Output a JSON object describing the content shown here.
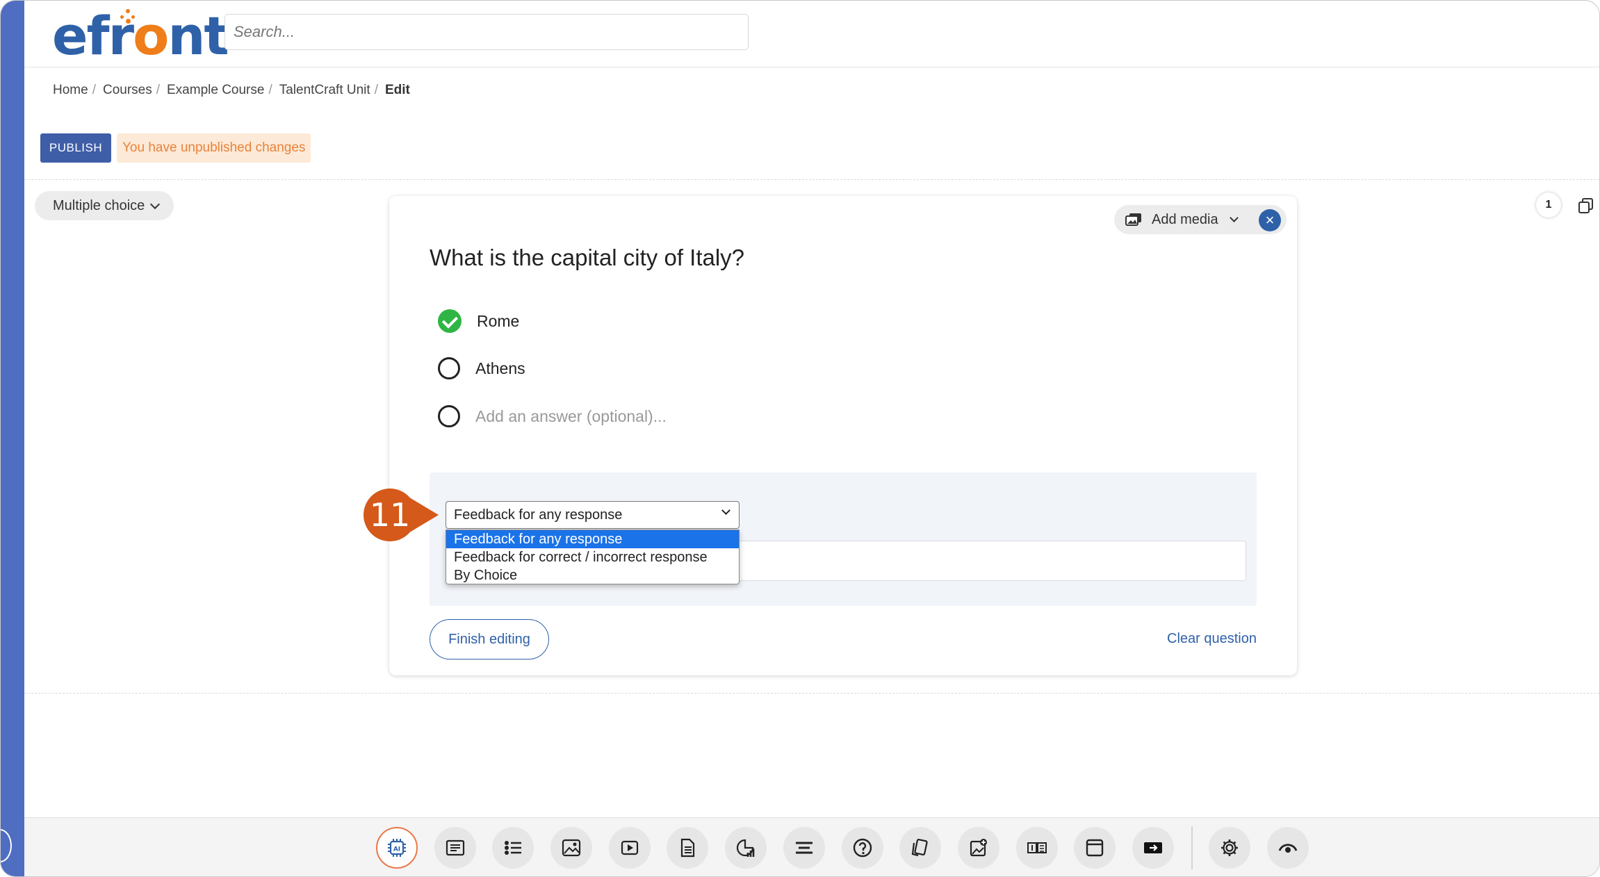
{
  "header": {
    "logo_text_a": "efr",
    "logo_text_o": "o",
    "logo_text_b": "nt",
    "search_placeholder": "Search..."
  },
  "breadcrumb": {
    "items": [
      "Home",
      "Courses",
      "Example Course",
      "TalentCraft Unit"
    ],
    "current": "Edit",
    "separator": "/"
  },
  "publish": {
    "button_label": "PUBLISH",
    "status_text": "You have unpublished changes"
  },
  "question_type": {
    "label": "Multiple choice"
  },
  "pagination": {
    "page": "1"
  },
  "card": {
    "add_media_label": "Add media",
    "close_symbol": "×",
    "question_text": "What is the capital city of Italy?",
    "answers": [
      {
        "text": "Rome",
        "correct": true
      },
      {
        "text": "Athens",
        "correct": false
      }
    ],
    "add_answer_placeholder": "Add an answer (optional)...",
    "feedback_select": {
      "selected": "Feedback for any response",
      "options": [
        "Feedback for any response",
        "Feedback for correct / incorrect response",
        "By Choice"
      ]
    },
    "finish_label": "Finish editing",
    "clear_label": "Clear question"
  },
  "step_marker": {
    "number": "11",
    "color": "#d4591a"
  },
  "toolbar": {
    "icons": [
      "ai-icon",
      "text-icon",
      "list-icon",
      "image-icon",
      "video-icon",
      "document-icon",
      "chart-icon",
      "lines-icon",
      "question-icon",
      "cards-icon",
      "image-gallery-icon",
      "numbered-icon",
      "window-icon",
      "embed-icon",
      "gear-icon",
      "eye-icon"
    ],
    "ai_label": "AI"
  },
  "colors": {
    "accent": "#2f61a8",
    "rail": "#4f6ec2",
    "warning_text": "#e8833a",
    "warning_bg": "#fde9d7",
    "correct": "#2fb543"
  }
}
